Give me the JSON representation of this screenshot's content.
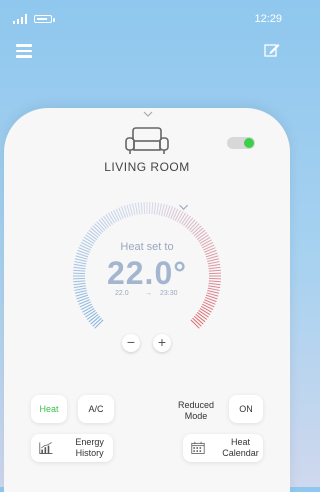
{
  "status_bar": {
    "time": "12:29",
    "icons": [
      "signal-icon",
      "battery-icon"
    ]
  },
  "toolbar": {
    "icons": [
      "menu-icon",
      "edit-icon"
    ]
  },
  "room": {
    "name": "LIVING ROOM",
    "icon": "sofa-icon",
    "toggle_on": true
  },
  "thermostat": {
    "title": "Heat set to",
    "temperature": "22.0°",
    "from": "22.0",
    "arrow": "→",
    "until": "23:30",
    "minus_label": "−",
    "plus_label": "+"
  },
  "controls": {
    "heat_label": "Heat",
    "ac_label": "A/C",
    "reduced_mode_label": "Reduced Mode",
    "reduced_mode_value": "ON",
    "energy_history_label": "Energy History",
    "heat_calendar_label": "Heat Calendar"
  },
  "colors": {
    "accent_green": "#3ccf4a",
    "cool_blue": "#7fb2e0",
    "warm_red": "#e06a70"
  }
}
